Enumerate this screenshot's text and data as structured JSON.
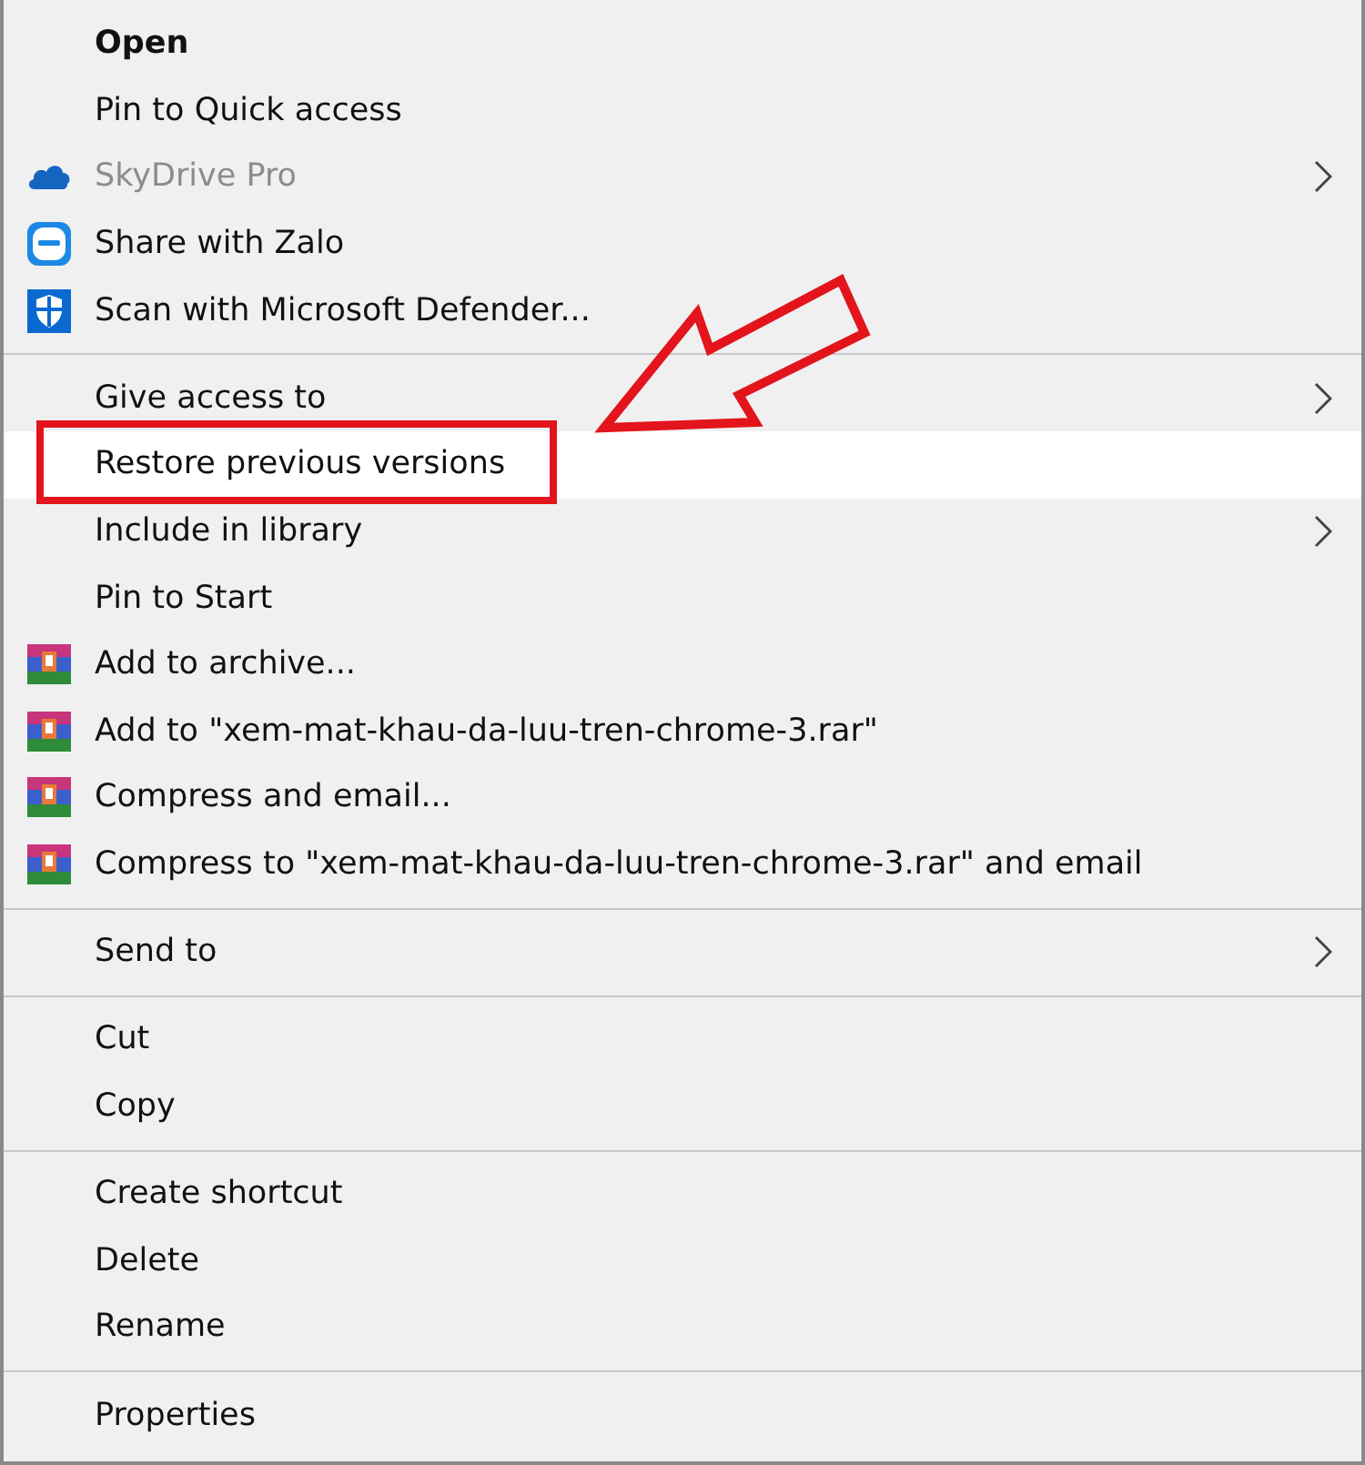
{
  "menu": {
    "items": [
      {
        "kind": "plain",
        "label": "Open",
        "bold": true,
        "selected": false
      },
      {
        "kind": "plain",
        "label": "Pin to Quick access",
        "selected": false
      },
      {
        "kind": "cloud",
        "label": "SkyDrive Pro",
        "disabled": true,
        "submenu": true,
        "selected": false
      },
      {
        "kind": "chat",
        "label": "Share with Zalo",
        "selected": false
      },
      {
        "kind": "shield",
        "label": "Scan with Microsoft Defender...",
        "selected": false
      },
      {
        "kind": "separator"
      },
      {
        "kind": "plain",
        "label": "Give access to",
        "submenu": true,
        "selected": false
      },
      {
        "kind": "plain",
        "label": "Restore previous versions",
        "selected": true
      },
      {
        "kind": "plain",
        "label": "Include in library",
        "submenu": true,
        "selected": false
      },
      {
        "kind": "plain",
        "label": "Pin to Start",
        "selected": false
      },
      {
        "kind": "archive",
        "label": "Add to archive...",
        "selected": false
      },
      {
        "kind": "archive",
        "label": "Add to \"xem-mat-khau-da-luu-tren-chrome-3.rar\"",
        "selected": false
      },
      {
        "kind": "archive",
        "label": "Compress and email...",
        "selected": false
      },
      {
        "kind": "archive",
        "label": "Compress to \"xem-mat-khau-da-luu-tren-chrome-3.rar\" and email",
        "selected": false
      },
      {
        "kind": "separator"
      },
      {
        "kind": "plain",
        "label": "Send to",
        "submenu": true,
        "selected": false
      },
      {
        "kind": "separator"
      },
      {
        "kind": "plain",
        "label": "Cut",
        "selected": false
      },
      {
        "kind": "plain",
        "label": "Copy",
        "selected": false
      },
      {
        "kind": "separator"
      },
      {
        "kind": "plain",
        "label": "Create shortcut",
        "selected": false
      },
      {
        "kind": "plain",
        "label": "Delete",
        "selected": false
      },
      {
        "kind": "plain",
        "label": "Rename",
        "selected": false
      },
      {
        "kind": "separator"
      },
      {
        "kind": "plain",
        "label": "Properties",
        "selected": false
      }
    ]
  }
}
